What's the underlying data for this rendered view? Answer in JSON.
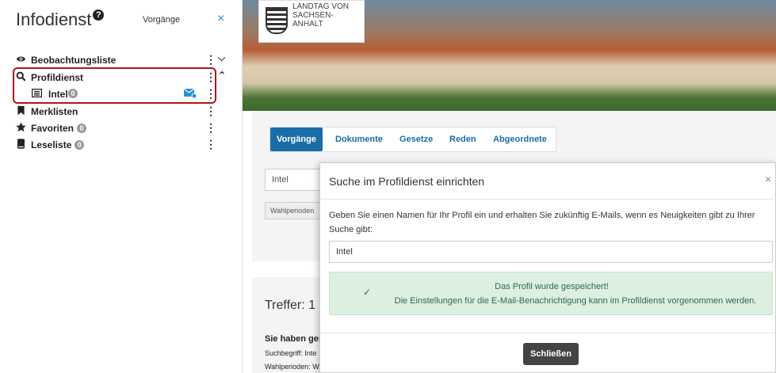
{
  "sidebar": {
    "title": "Infodienst",
    "help_icon": "?",
    "tab_label": "Vorgänge",
    "close_label": "×",
    "items": [
      {
        "label": "Beobachtungsliste",
        "icon": "eye-icon"
      },
      {
        "label": "Profildienst",
        "icon": "search-icon"
      },
      {
        "label": "Merklisten",
        "icon": "bookmark-icon"
      },
      {
        "label": "Favoriten",
        "icon": "star-icon",
        "badge": "0"
      },
      {
        "label": "Leseliste",
        "icon": "book-icon",
        "badge": "0"
      }
    ],
    "subitem": {
      "label": "Intel",
      "badge": "0"
    }
  },
  "header": {
    "logo_line1": "LANDTAG VON",
    "logo_line2": "SACHSEN-ANHALT"
  },
  "tabs": [
    "Vorgänge",
    "Dokumente",
    "Gesetze",
    "Reden",
    "Abgeordnete"
  ],
  "background": {
    "search_value": "Intel",
    "chip_label": "Wahlperioden",
    "result_title": "Treffer: 1",
    "line1": "Sie haben ges",
    "line2": "Suchbegriff: Inte",
    "line3": "Wahlperioden: W"
  },
  "modal": {
    "title": "Suche im Profildienst einrichten",
    "close": "×",
    "description": "Geben Sie einen Namen für Ihr Profil ein und erhalten Sie zukünftig E-Mails, wenn es Neuigkeiten gibt zu Ihrer Suche gibt:",
    "input_value": "Intel",
    "alert_line1": "Das Profil wurde gespeichert!",
    "alert_line2": "Die Einstellungen für die E-Mail-Benachrichtigung kann im Profildienst vorgenommen werden.",
    "button_label": "Schließen"
  },
  "colors": {
    "accent": "#1a6ea8",
    "highlight": "#b11616",
    "success_bg": "#dcefe1"
  }
}
